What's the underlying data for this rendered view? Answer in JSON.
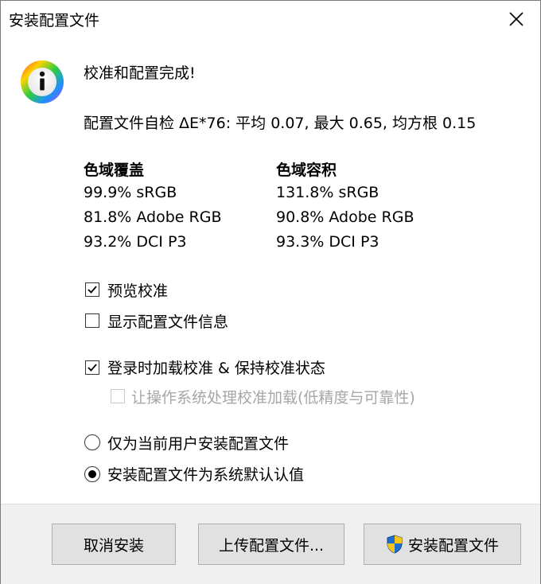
{
  "window": {
    "title": "安装配置文件",
    "close_icon": "close-icon"
  },
  "message": {
    "icon": "info-icon",
    "headline": "校准和配置完成!",
    "self_check": "配置文件自检 ΔE*76: 平均 0.07, 最大 0.65, 均方根 0.15"
  },
  "gamut": {
    "coverage": {
      "header": "色域覆盖",
      "items": [
        "99.9% sRGB",
        "81.8% Adobe RGB",
        "93.2% DCI P3"
      ]
    },
    "volume": {
      "header": "色域容积",
      "items": [
        "131.8% sRGB",
        "90.8% Adobe RGB",
        "93.3% DCI P3"
      ]
    }
  },
  "options": {
    "preview_calibration": {
      "label": "预览校准",
      "checked": true
    },
    "show_profile_info": {
      "label": "显示配置文件信息",
      "checked": false
    },
    "load_on_login": {
      "label": "登录时加载校准 & 保持校准状态",
      "checked": true
    },
    "os_handle_loading": {
      "label": "让操作系统处理校准加载(低精度与可靠性)",
      "checked": false,
      "disabled": true
    }
  },
  "install_scope": {
    "current_user": {
      "label": "仅为当前用户安装配置文件",
      "selected": false
    },
    "system_default": {
      "label": "安装配置文件为系统默认认值",
      "selected": true
    }
  },
  "buttons": {
    "cancel": "取消安装",
    "upload": "上传配置文件...",
    "install": "安装配置文件",
    "install_icon": "shield-icon"
  },
  "colors": {
    "footer_bg": "#f0f0f0",
    "button_bg": "#e1e1e1",
    "disabled_text": "#a6a6a6"
  }
}
